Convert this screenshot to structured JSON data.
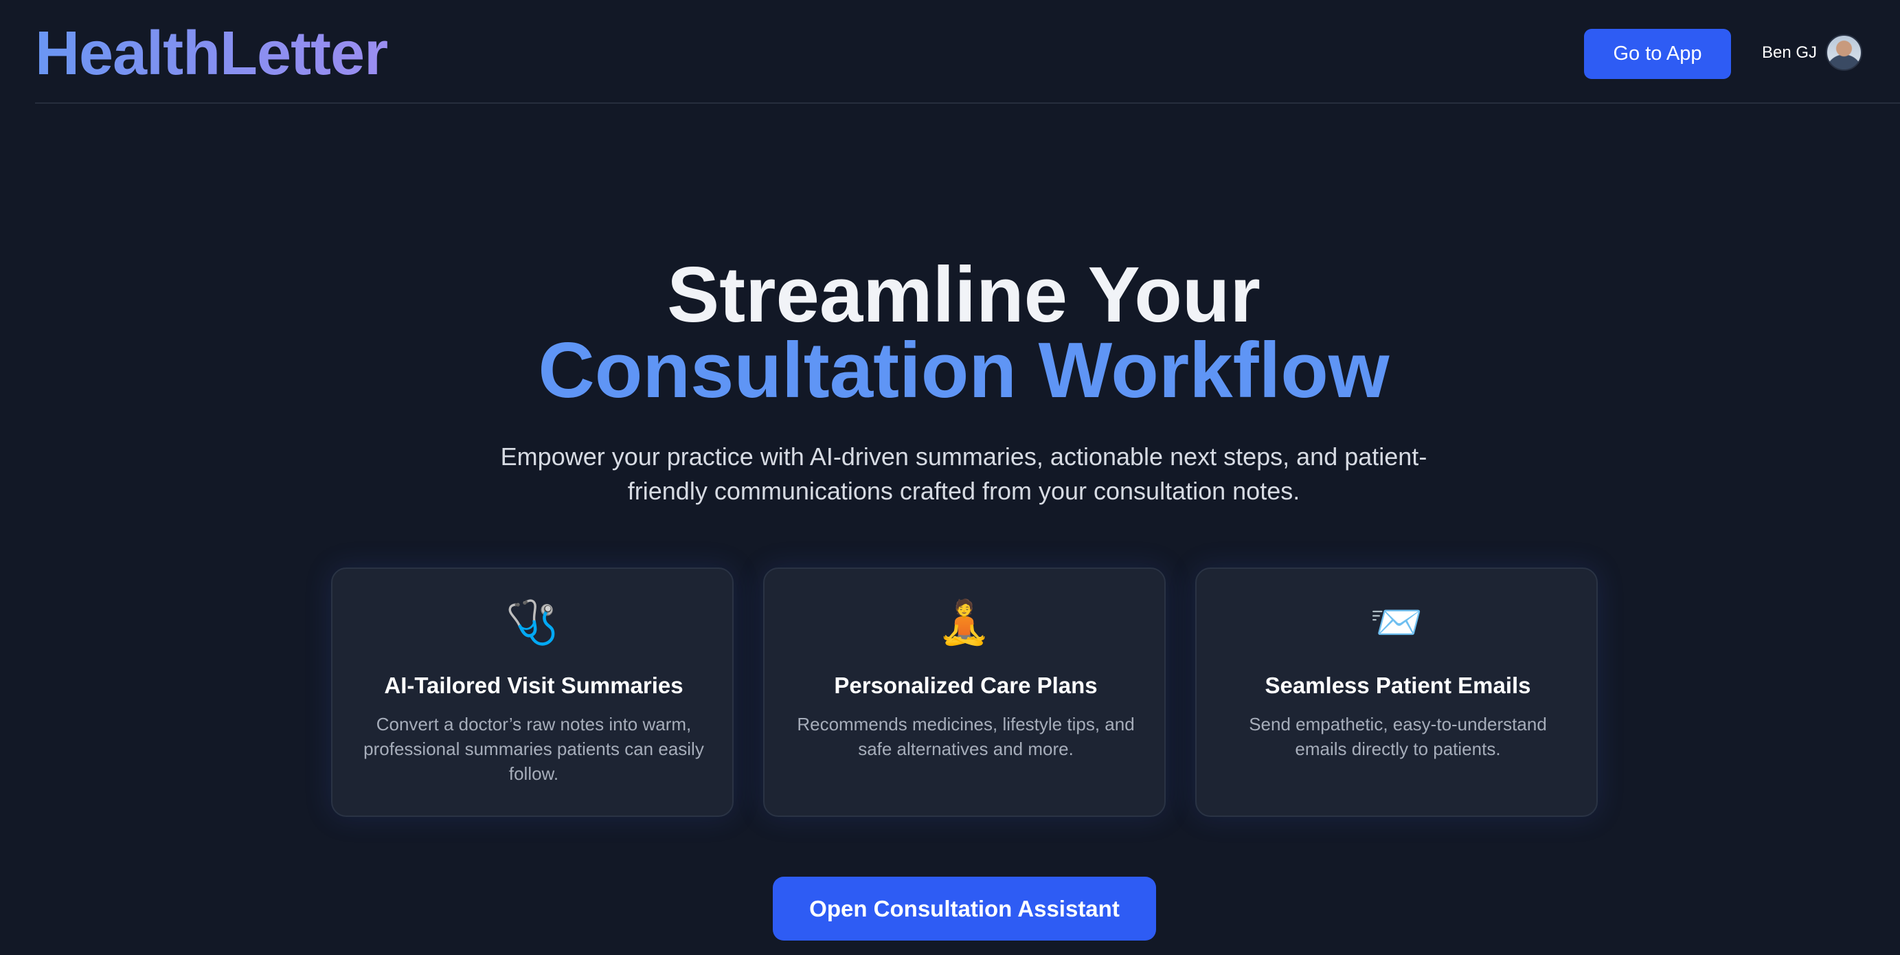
{
  "header": {
    "logo": "HealthLetter",
    "go_to_app_label": "Go to App",
    "user_name": "Ben GJ"
  },
  "hero": {
    "title_line1": "Streamline Your",
    "title_line2": "Consultation Workflow",
    "subtitle": "Empower your practice with AI-driven summaries, actionable next steps, and patient-friendly communications crafted from your consultation notes."
  },
  "features": [
    {
      "icon": "stethoscope-icon",
      "icon_glyph": "🩺",
      "title": "AI-Tailored Visit Summaries",
      "description": "Convert a doctor’s raw notes into warm, professional summaries patients can easily follow."
    },
    {
      "icon": "meditation-icon",
      "icon_glyph": "🧘",
      "title": "Personalized Care Plans",
      "description": "Recommends medicines, lifestyle tips, and safe alternatives and more."
    },
    {
      "icon": "inbox-mail-icon",
      "icon_glyph": "📨",
      "title": "Seamless Patient Emails",
      "description": "Send empathetic, easy-to-understand emails directly to patients."
    }
  ],
  "cta": {
    "label": "Open Consultation Assistant"
  },
  "colors": {
    "background": "#121826",
    "accent": "#2e5cf4",
    "highlight": "#5f95f5",
    "card": "#1d2433"
  }
}
